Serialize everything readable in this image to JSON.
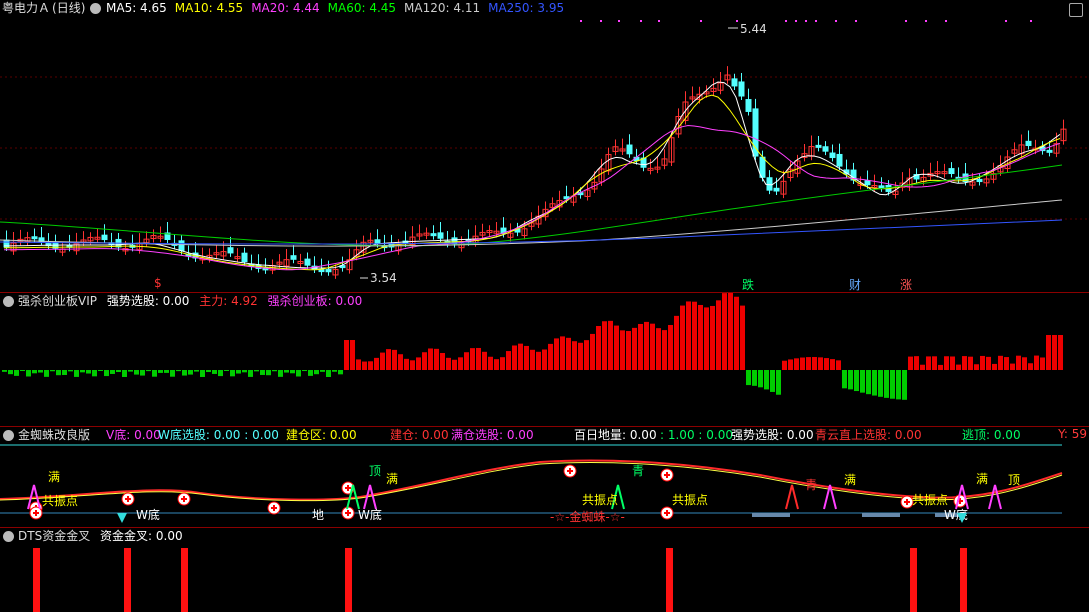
{
  "main": {
    "stock_name": "粤电力Ａ",
    "period": "(日线)",
    "ma_labels": [
      {
        "label": "MA5: 4.65",
        "color": "#ffffff"
      },
      {
        "label": "MA10: 4.55",
        "color": "#ffff00"
      },
      {
        "label": "MA20: 4.44",
        "color": "#ff40ff"
      },
      {
        "label": "MA60: 4.45",
        "color": "#00ff00"
      },
      {
        "label": "MA120: 4.11",
        "color": "#cccccc"
      },
      {
        "label": "MA250: 3.95",
        "color": "#3355ff"
      }
    ],
    "high_label": "5.44",
    "low_label": "3.54",
    "markers": [
      {
        "text": "$",
        "color": "#ff3333"
      },
      {
        "text": "跌",
        "color": "#00ff66"
      },
      {
        "text": "财",
        "color": "#66aaff"
      },
      {
        "text": "涨",
        "color": "#ff5555"
      }
    ],
    "colors": {
      "up": "#ff3333",
      "down": "#54ffff"
    }
  },
  "panel2": {
    "title": "强杀创业板VIP",
    "items": [
      {
        "label": "强势选股: 0.00",
        "color": "#ffffff"
      },
      {
        "label": "主力: 4.92",
        "color": "#ff3333"
      },
      {
        "label": "强杀创业板: 0.00",
        "color": "#ff40ff"
      }
    ]
  },
  "panel3": {
    "title": "金蜘蛛改良版",
    "items": [
      {
        "label": "V底: 0.00",
        "color": "#ff40ff"
      },
      {
        "label": "W底选股: 0.00 : 0.00",
        "color": "#54ffff"
      },
      {
        "label": "建仓区: 0.00",
        "color": "#ffff00"
      },
      {
        "label": "建仓: 0.00",
        "color": "#ff3333"
      },
      {
        "label": "满仓选股: 0.00",
        "color": "#ff40ff"
      },
      {
        "label": "百日地量: 0.00",
        "color": "#ffffff"
      },
      {
        "label": ": 1.00 : 0.00",
        "color": "#00ff66"
      },
      {
        "label": "强势选股: 0.00",
        "color": "#ffffff"
      },
      {
        "label": "青云直上选股: 0.00",
        "color": "#ff3333"
      },
      {
        "label": "逃顶: 0.00",
        "color": "#00ff66"
      }
    ],
    "ylabel": "Y: 59",
    "annotations": [
      "满",
      "满",
      "满",
      "满",
      "顶",
      "顶",
      "青",
      "青",
      "共振点",
      "共振点",
      "共振点",
      "共振点",
      "W底",
      "W底",
      "W底",
      "地",
      "-☆-金蜘蛛-☆-"
    ]
  },
  "panel4": {
    "title": "DTS资金金叉",
    "items": [
      {
        "label": "资金金叉: 0.00",
        "color": "#ffffff"
      }
    ]
  }
}
